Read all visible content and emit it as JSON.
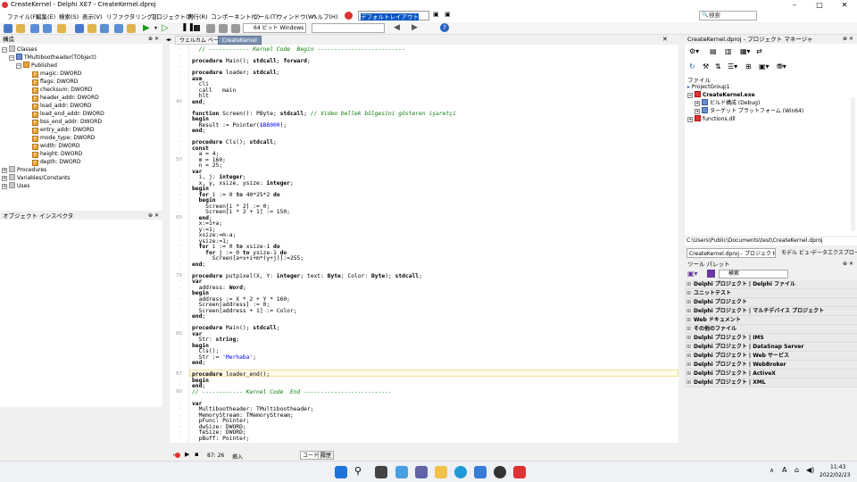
{
  "window": {
    "title": "CreateKernel - Delphi XE7 - CreateKernel.dproj"
  },
  "menu": [
    "ファイル(F)",
    "編集(E)",
    "検索(S)",
    "表示(V)",
    "リファクタリング(J)",
    "プロジェクト(P)",
    "実行(R)",
    "コンポーネント(C)",
    "ツール(T)",
    "ウィンドウ(W)",
    "ヘルプ(H)"
  ],
  "layout_combo": "デフォルトレイアウト",
  "search_placeholder": "検索",
  "platform_combo": "64 ビット Windows",
  "tabs": [
    "ウェルカム ページ",
    "CreateKernel"
  ],
  "structure": {
    "title": "構造",
    "rows": [
      "Classes",
      "TMultibootheader(TObject)",
      "Published",
      "magic: DWORD",
      "flags: DWORD",
      "checksum: DWORD",
      "header_addr: DWORD",
      "load_addr: DWORD",
      "load_end_addr: DWORD",
      "bss_end_addr: DWORD",
      "entry_addr: DWORD",
      "mode_type: DWORD",
      "width: DWORD",
      "height: DWORD",
      "depth: DWORD",
      "Procedures",
      "Variables/Constants",
      "Uses"
    ]
  },
  "objinsp": {
    "title": "オブジェクト インスペクタ"
  },
  "code": {
    "lines": [
      "  // ------------ Kernel Code  Begin --------------------------",
      "",
      "procedure Main(); stdcall; forward;",
      "",
      "procedure loader; stdcall;",
      "asm",
      "  cli",
      "  call   main",
      "  hlt",
      "end;",
      "",
      "function Screen(): PByte; stdcall; // Video bellek bölgesini gösteren işaretçi",
      "begin",
      "  Result := Pointer($B8000);",
      "end;",
      "",
      "procedure Cls(); stdcall;",
      "const",
      "  a = 4;",
      "  m = 160;",
      "  n = 25;",
      "var",
      "  i, j: integer;",
      "  x, y, xsize, ysize: integer;",
      "begin",
      "  for i := 0 to 40*25*2 do",
      "  begin",
      "    Screen[i * 2] := 0;",
      "    Screen[i * 2 + 1] := 150;",
      "  end;",
      "  x:=1+a;",
      "  y:=1;",
      "  xsize:=m-a;",
      "  ysize:=1;",
      "  for i := 0 to xsize-1 do",
      "    for j := 0 to ysize-1 do",
      "      Screen[a+x+i+m*(y+j)]:=255;",
      "end;",
      "",
      "procedure putpixel(X, Y: integer; text: Byte; Color: Byte); stdcall;",
      "var",
      "  address: Word;",
      "begin",
      "  address := X * 2 + Y * 160;",
      "  Screen[address] := 0;",
      "  Screen[address + 1] := Color;",
      "end;",
      "",
      "procedure Main(); stdcall;",
      "var",
      "  Str: string;",
      "begin",
      "  Cls();",
      "  Str := 'Merhaba';",
      "end;",
      "",
      "procedure loader_end();",
      "begin",
      "end;",
      "// ------------ Kernel Code  End --------------------------",
      "",
      "var",
      "  Multibootheader: TMultibootheader;",
      "  MemoryStream: TMemoryStream;",
      "  pFunc: Pointer;",
      "  dwSize: DWORD;",
      "  feSize: DWORD;",
      "  pBuff: Pointer;"
    ],
    "line_numbers": [
      "40",
      "50",
      "60",
      "70",
      "80",
      "87",
      "90"
    ]
  },
  "status": {
    "position": "87: 26",
    "mode": "挿入",
    "tab_code": "コード",
    "tab_history": "履歴"
  },
  "project": {
    "title": "CreateKernel.dproj - プロジェクト マネージャ",
    "file_label": "ファイル",
    "items": [
      "ProjectGroup1",
      "CreateKernel.exe",
      "ビルド構成 (Debug)",
      "ターゲット プラットフォーム (Win64)",
      "functions.dll"
    ],
    "path": "C:\\Users\\Public\\Documents\\test\\CreateKernel.dproj",
    "bottom_tabs": [
      "CreateKernel.dproj - プロジェクト マネ...",
      "モデル ビュー",
      "データエクスプローラ"
    ]
  },
  "palette": {
    "title": "ツール パレット",
    "search": "検索",
    "rows": [
      "Delphi プロジェクト | Delphi ファイル",
      "ユニットテスト",
      "Delphi プロジェクト",
      "Delphi プロジェクト | マルチデバイス プロジェクト",
      "Web ドキュメント",
      "その他のファイル",
      "Delphi プロジェクト | IMS",
      "Delphi プロジェクト | DataSnap Server",
      "Delphi プロジェクト | Web サービス",
      "Delphi プロジェクト | WebBroker",
      "Delphi プロジェクト | ActiveX",
      "Delphi プロジェクト | XML"
    ]
  },
  "taskbar": {
    "time": "11:43",
    "date": "2022/02/23",
    "ime": "A"
  }
}
